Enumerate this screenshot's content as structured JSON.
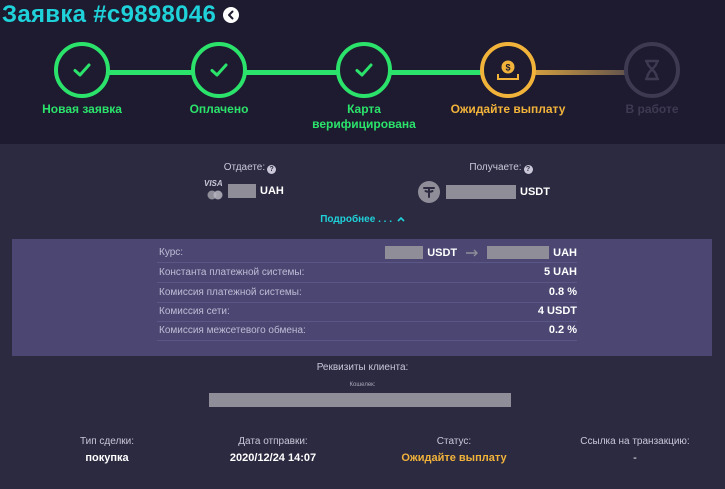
{
  "header": {
    "title": "Заявка #c9898046"
  },
  "steps": [
    {
      "label": "Новая заявка",
      "state": "done"
    },
    {
      "label": "Оплачено",
      "state": "done"
    },
    {
      "label": "Карта верифицирована",
      "state": "done"
    },
    {
      "label": "Ожидайте выплату",
      "state": "current"
    },
    {
      "label": "В работе",
      "state": "pending"
    }
  ],
  "exchange": {
    "give_label": "Отдаете:",
    "give_currency": "UAH",
    "give_brand": "VISA",
    "receive_label": "Получаете:",
    "receive_currency": "USDT"
  },
  "more_link": "Подробнее . . .",
  "details": [
    {
      "key": "Курс:",
      "from_currency": "USDT",
      "to_currency": "UAH"
    },
    {
      "key": "Константа платежной системы:",
      "value": "5 UAH"
    },
    {
      "key": "Комиссия платежной системы:",
      "value": "0.8 %"
    },
    {
      "key": "Комиссия сети:",
      "value": "4 USDT"
    },
    {
      "key": "Комиссия межсетевого обмена:",
      "value": "0.2 %"
    }
  ],
  "requisites": {
    "label": "Реквизиты клиента:",
    "wallet_label": "Кошелек:"
  },
  "footer": [
    {
      "key": "Тип сделки:",
      "value": "покупка"
    },
    {
      "key": "Дата отправки:",
      "value": "2020/12/24 14:07"
    },
    {
      "key": "Статус:",
      "value": "Ожидайте выплату"
    },
    {
      "key": "Ссылка на транзакцию:",
      "value": "-"
    }
  ],
  "colors": {
    "accent": "#1fd1d9",
    "done": "#2be36b",
    "current": "#f2b33a",
    "pending": "#3d3a52",
    "background": "#1e1b30",
    "panel": "#2c2a40",
    "details": "#4b4772"
  }
}
